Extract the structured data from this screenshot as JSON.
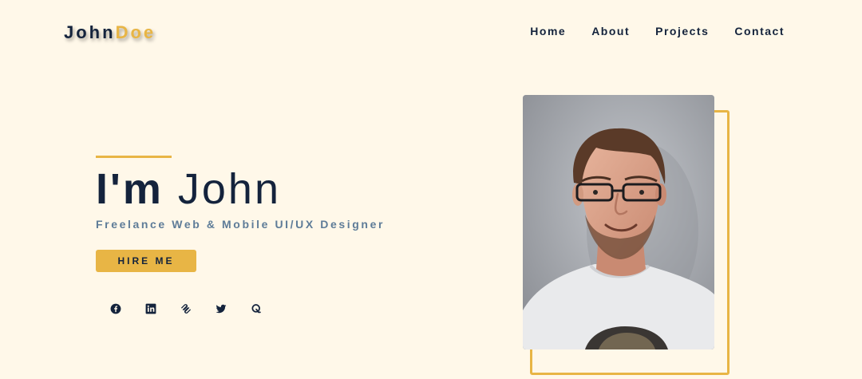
{
  "header": {
    "logo_first": "John",
    "logo_last": "Doe",
    "nav": [
      {
        "label": "Home"
      },
      {
        "label": "About"
      },
      {
        "label": "Projects"
      },
      {
        "label": "Contact"
      }
    ]
  },
  "hero": {
    "title_im": "I'm",
    "title_name": "John",
    "subtitle": "Freelance Web & Mobile UI/UX Designer",
    "cta_label": "HIRE ME"
  },
  "socials": [
    {
      "icon": "facebook-icon"
    },
    {
      "icon": "linkedin-icon"
    },
    {
      "icon": "squarespace-icon"
    },
    {
      "icon": "twitter-icon"
    },
    {
      "icon": "quora-icon"
    }
  ],
  "colors": {
    "background": "#fff8e9",
    "navy": "#14233c",
    "accent": "#e8b545",
    "muted": "#5e7c98"
  }
}
